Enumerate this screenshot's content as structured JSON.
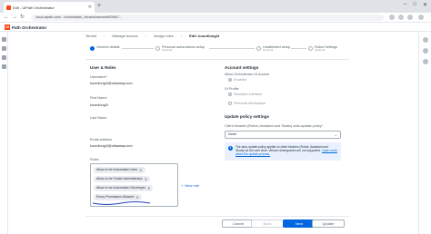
{
  "browser": {
    "tab_title": "Edit - UiPath Orchestrator",
    "new_tab_symbol": "+",
    "url": "cloud.uipath.com/.../orchestrator_/tenant/users/edit/20847...",
    "window_controls": [
      "–",
      "□",
      "✕"
    ]
  },
  "app": {
    "logo_mark": "Ui",
    "logo_text": "Path Orchestrator"
  },
  "breadcrumb": {
    "items": [
      "Tenant",
      "Manage Access",
      "Assign roles",
      "Edit: kourdlong2t"
    ]
  },
  "stepper": {
    "steps": [
      {
        "label": "General details",
        "sub": ""
      },
      {
        "label": "Personal automations setup",
        "sub": "Optional"
      },
      {
        "label": "Unattended setup",
        "sub": "Optional"
      },
      {
        "label": "Robot Settings",
        "sub": "Optional"
      }
    ]
  },
  "user_roles": {
    "section_title": "User & Roles",
    "username_label": "Username*",
    "username_value": "kourdlong2t@ultawaay.com",
    "first_name_label": "First Name",
    "first_name_value": "kourdlong2t",
    "last_name_label": "Last Name",
    "email_label": "Email address",
    "email_value": "kourdlong2t@ultawaay.com",
    "roles_label": "Roles",
    "roles": [
      "Allow to be Automation User",
      "Allow to be Folder Administrator",
      "Allow to be Automation Developer",
      "Every Permission Allowed"
    ],
    "new_role_label": "New role",
    "new_role_icon": "+"
  },
  "account_settings": {
    "section_title": "Account settings",
    "allow_orchestrator_label": "Allow Orchestrator UI Access",
    "allow_orchestrator_option": "Enabled",
    "ui_profile_label": "UI Profile",
    "ui_profile_options": [
      "Standard Interface",
      "Personal Workspace"
    ],
    "update_policy_title": "Update policy settings",
    "update_policy_label": "Client binaries (Robot, Assistant and Studio) auto-update policy*",
    "update_policy_value": "None",
    "info_text": "The auto-update policy applies to client binaries (Robot, Assistant and Studio) at the user level. Version downgrades are not supported.",
    "info_link": "Learn more about the update process."
  },
  "footer": {
    "cancel": "Cancel",
    "back": "Back",
    "next": "Next",
    "update": "Update"
  },
  "colors": {
    "accent": "#0067df",
    "brand": "#fa4616"
  }
}
